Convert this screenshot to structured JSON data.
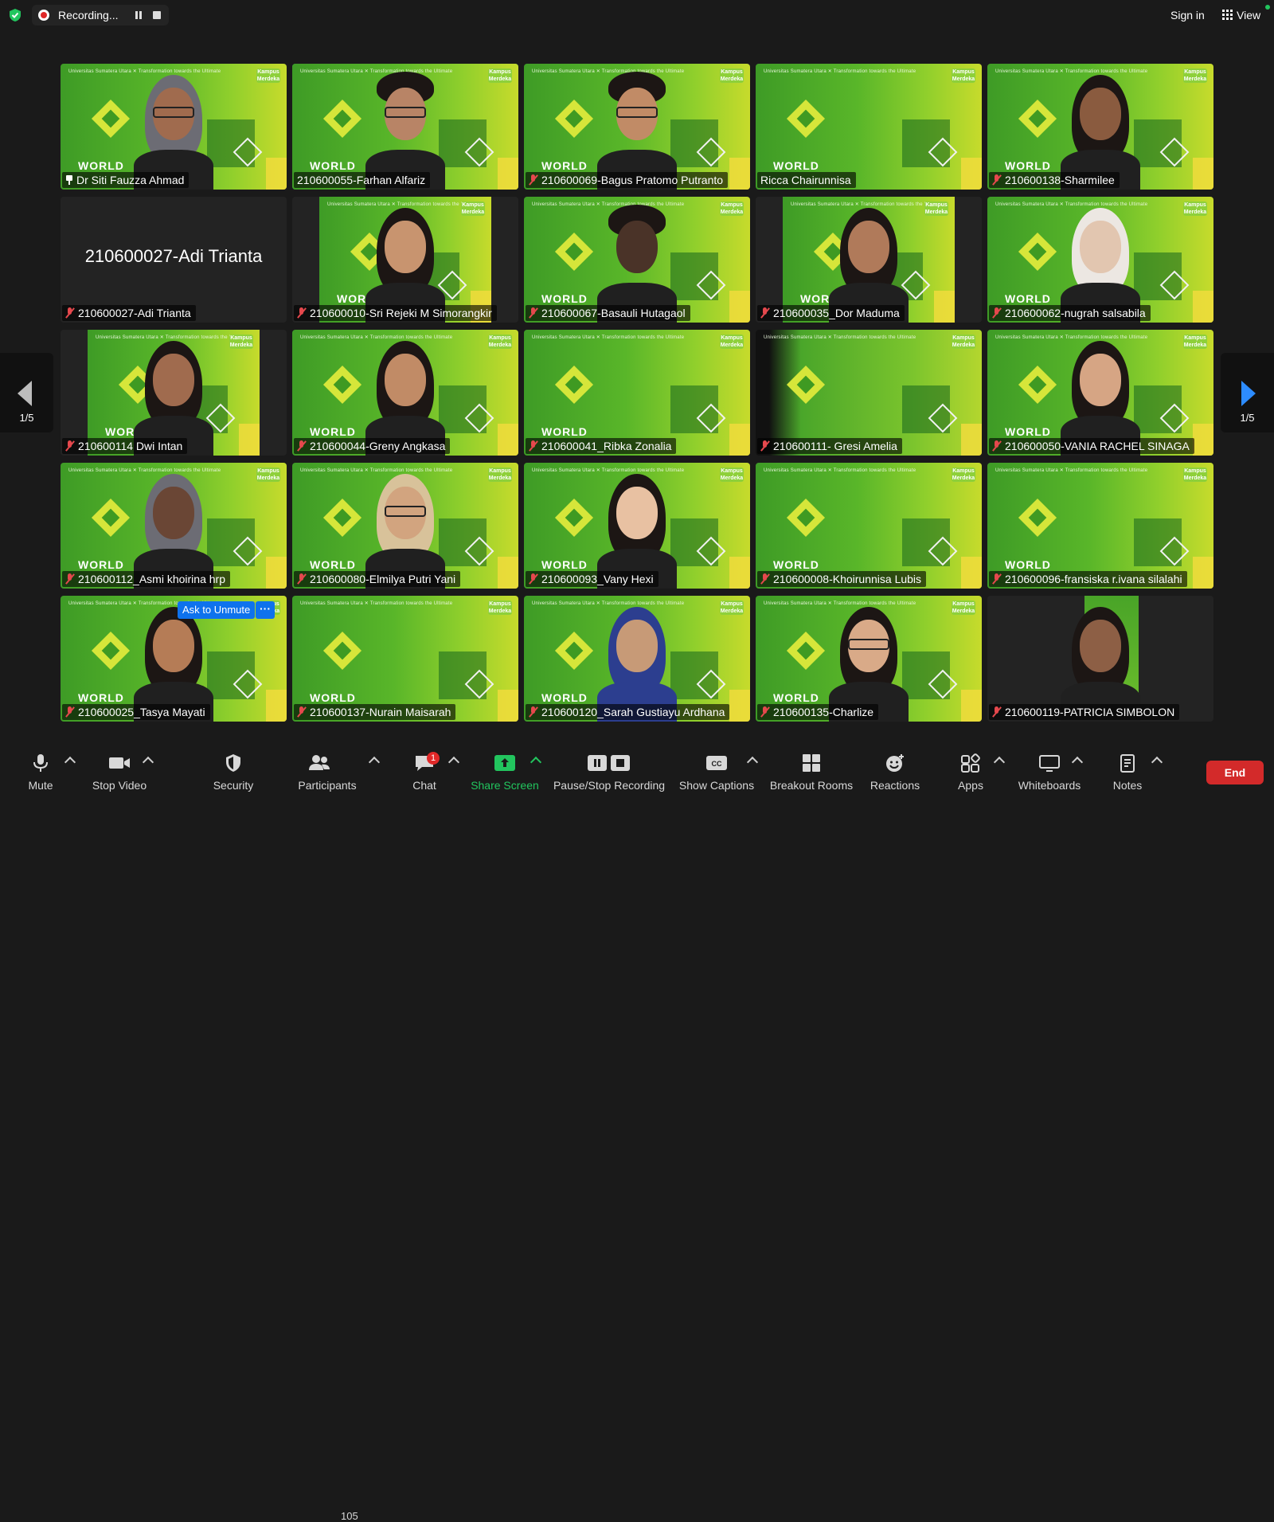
{
  "topbar": {
    "recording_label": "Recording...",
    "sign_in_label": "Sign in",
    "view_label": "View"
  },
  "nav": {
    "left_page": "1/5",
    "right_page": "1/5"
  },
  "background": {
    "header_text": "Universitas Sumatera Utara  ✕ Transformation towards the Ultimate",
    "kampus_text": "Kampus Merdeka",
    "world_text": "WORLD"
  },
  "tiles": [
    {
      "name": "Dr Siti Fauzza Ahmad",
      "icon": "pin-icon"
    },
    {
      "name": "210600055-Farhan Alfariz",
      "icon": "none"
    },
    {
      "name": "210600069-Bagus Pratomo Putranto",
      "icon": "mic-muted-icon"
    },
    {
      "name": "Ricca Chairunnisa",
      "icon": "none"
    },
    {
      "name": "210600138-Sharmilee",
      "icon": "mic-muted-icon"
    },
    {
      "name": "210600027-Adi Trianta",
      "icon": "mic-muted-icon",
      "video_off_name": "210600027-Adi Trianta"
    },
    {
      "name": "210600010-Sri Rejeki M Simorangkir",
      "icon": "mic-muted-icon"
    },
    {
      "name": "210600067-Basauli Hutagaol",
      "icon": "mic-muted-icon"
    },
    {
      "name": "210600035_Dor Maduma",
      "icon": "mic-muted-icon"
    },
    {
      "name": "210600062-nugrah salsabila",
      "icon": "mic-muted-icon"
    },
    {
      "name": "210600114 Dwi Intan",
      "icon": "mic-muted-icon"
    },
    {
      "name": "210600044-Greny Angkasa",
      "icon": "mic-muted-icon"
    },
    {
      "name": "210600041_Ribka Zonalia",
      "icon": "mic-muted-icon"
    },
    {
      "name": "210600111- Gresi Amelia",
      "icon": "mic-muted-icon"
    },
    {
      "name": "210600050-VANIA RACHEL SINAGA",
      "icon": "mic-muted-icon"
    },
    {
      "name": "210600112_Asmi khoirina hrp",
      "icon": "mic-muted-icon"
    },
    {
      "name": "210600080-Elmilya Putri Yani",
      "icon": "mic-muted-icon"
    },
    {
      "name": "210600093_Vany Hexi",
      "icon": "mic-muted-icon"
    },
    {
      "name": "210600008-Khoirunnisa Lubis",
      "icon": "mic-muted-icon"
    },
    {
      "name": "210600096-fransiska r.ivana silalahi",
      "icon": "mic-muted-icon"
    },
    {
      "name": "210600025_Tasya Mayati",
      "icon": "mic-muted-icon",
      "ask_unmute": "Ask to Unmute",
      "more": "···"
    },
    {
      "name": "210600137-Nurain Maisarah",
      "icon": "mic-muted-icon"
    },
    {
      "name": "210600120_Sarah Gustiayu Ardhana",
      "icon": "mic-muted-icon"
    },
    {
      "name": "210600135-Charlize",
      "icon": "mic-muted-icon"
    },
    {
      "name": "210600119-PATRICIA SIMBOLON",
      "icon": "mic-muted-icon"
    }
  ],
  "toolbar": {
    "mute": "Mute",
    "stop_video": "Stop Video",
    "security": "Security",
    "participants": "Participants",
    "participants_count": "105",
    "chat": "Chat",
    "chat_badge": "1",
    "share_screen": "Share Screen",
    "pause_stop_recording": "Pause/Stop Recording",
    "show_captions": "Show Captions",
    "breakout_rooms": "Breakout Rooms",
    "reactions": "Reactions",
    "apps": "Apps",
    "whiteboards": "Whiteboards",
    "notes": "Notes",
    "end": "End"
  },
  "colors": {
    "accent_blue": "#0e72ed",
    "end_red": "#d32a2a",
    "share_green": "#22c55e",
    "muted_red": "#e5484d",
    "bg_green": "#59b629"
  }
}
